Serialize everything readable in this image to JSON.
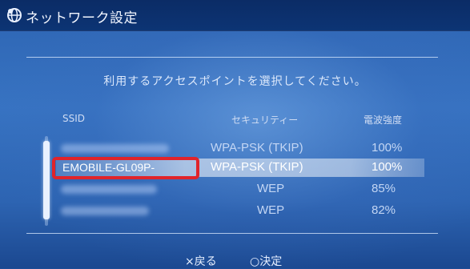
{
  "window": {
    "title": "ネットワーク設定",
    "title_icon": "network-globe-icon"
  },
  "prompt": "利用するアクセスポイントを選択してください。",
  "columns": {
    "ssid": "SSID",
    "security": "セキュリティー",
    "signal": "電波強度"
  },
  "networks": [
    {
      "ssid": "",
      "ssid_obscured": true,
      "security": "WPA-PSK (TKIP)",
      "signal": "100%",
      "selected": false
    },
    {
      "ssid": "EMOBILE-GL09P-",
      "ssid_obscured": false,
      "security": "WPA-PSK (TKIP)",
      "signal": "100%",
      "selected": true
    },
    {
      "ssid": "",
      "ssid_obscured": true,
      "security": "WEP",
      "signal": "85%",
      "selected": false
    },
    {
      "ssid": "",
      "ssid_obscured": true,
      "security": "WEP",
      "signal": "82%",
      "selected": false
    }
  ],
  "footer": {
    "back_label": "×戻る",
    "confirm_label": "○決定"
  },
  "colors": {
    "background": "#2d64b2",
    "titlebar": "#0c3474",
    "highlight_box": "#e0242b"
  }
}
